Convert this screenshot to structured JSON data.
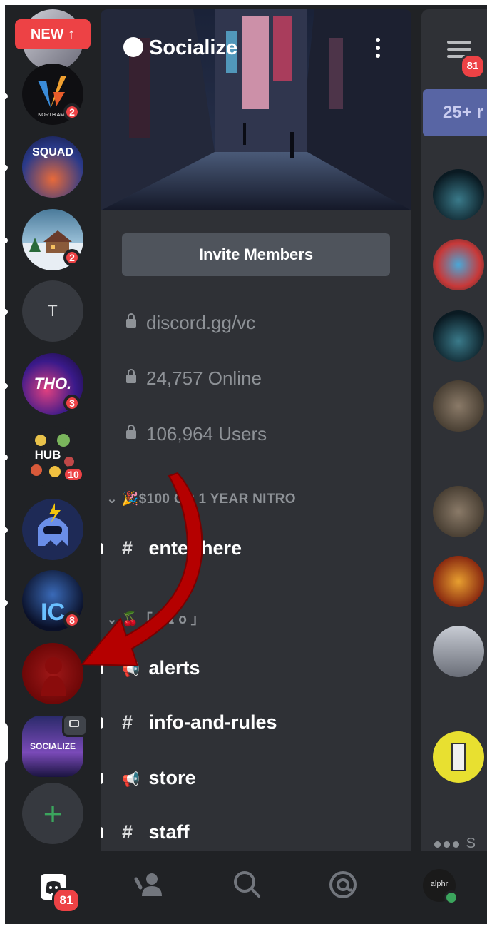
{
  "rail": {
    "new_label": "NEW",
    "servers": [
      {
        "name": "north-america-collegiate",
        "text": "NORTH AME",
        "badge": "2"
      },
      {
        "name": "squad",
        "text": "SQUAD",
        "badge": ""
      },
      {
        "name": "winter-cabin",
        "text": "",
        "badge": "2"
      },
      {
        "name": "t-server",
        "text": "T",
        "badge": ""
      },
      {
        "name": "tho-server",
        "text": "THO.",
        "badge": "3"
      },
      {
        "name": "the-hub",
        "text": "HUB",
        "badge": "10"
      },
      {
        "name": "lightning-ghost",
        "text": "",
        "badge": ""
      },
      {
        "name": "ic-dragon",
        "text": "IC",
        "badge": "8"
      },
      {
        "name": "red-server",
        "text": "",
        "badge": ""
      },
      {
        "name": "socialize",
        "text": "SOCIALIZE",
        "badge": ""
      }
    ]
  },
  "server": {
    "name": "Socialize",
    "invite_label": "Invite Members",
    "stats": [
      "discord.gg/vc",
      "24,757 Online",
      "106,964 Users"
    ],
    "categories": [
      {
        "label": "🎉$100 OR 1 YEAR NITRO"
      },
      {
        "label": "🍒「 ʀ ɪ ᴏ 」"
      }
    ],
    "channels": [
      {
        "glyph": "#",
        "name": "enter here"
      },
      {
        "glyph": "📢",
        "name": "alerts"
      },
      {
        "glyph": "#",
        "name": "info-and-rules"
      },
      {
        "glyph": "📢",
        "name": "store"
      },
      {
        "glyph": "#",
        "name": "staff"
      }
    ]
  },
  "members": {
    "menu_badge": "81",
    "age_chip": "25+ r",
    "typing": "S"
  },
  "bottom_nav": {
    "home_badge": "81",
    "profile_text": "alphr"
  },
  "colors": {
    "accent": "#ed4245",
    "arrow": "#c80000",
    "online": "#3ba55d"
  }
}
